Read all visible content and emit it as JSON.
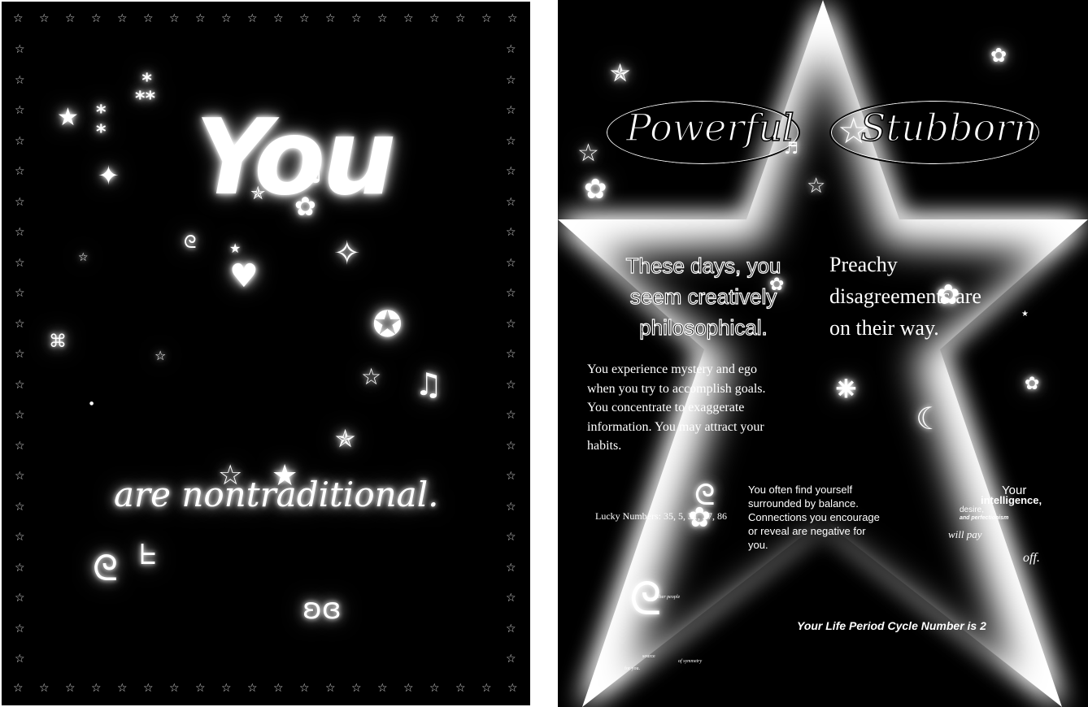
{
  "left_card": {
    "title": "You",
    "tagline": "are nontraditional."
  },
  "right_card": {
    "trait_1": "Powerful",
    "trait_2": "Stubborn",
    "outline_lines": [
      "These days, you",
      "seem creatively",
      "philosophical."
    ],
    "preachy_lines": [
      "Preachy",
      "disagreements are",
      "on their way."
    ],
    "mystery_lines": [
      "You experience mystery and ego",
      "when you try to accomplish goals.",
      "You concentrate to exaggerate",
      "information. You may attract your",
      "habits."
    ],
    "lucky_numbers": "Lucky Numbers: 35, 5, 31, 27, 86",
    "balance_lines": [
      "You often find yourself",
      "surrounded by balance.",
      "Connections you encourage",
      "or reveal are negative for",
      "you."
    ],
    "your_word": "Your",
    "intelligence_word": "intelligence,",
    "desire_word": "desire,",
    "perfection_text": "and perfectionism",
    "will_pay": "will pay",
    "off_word": "off.",
    "life_cycle": "Your Life Period Cycle Number is 2",
    "other_people": "other people",
    "symmetry": "of symmetry",
    "source": "source",
    "for_you": "for you."
  }
}
